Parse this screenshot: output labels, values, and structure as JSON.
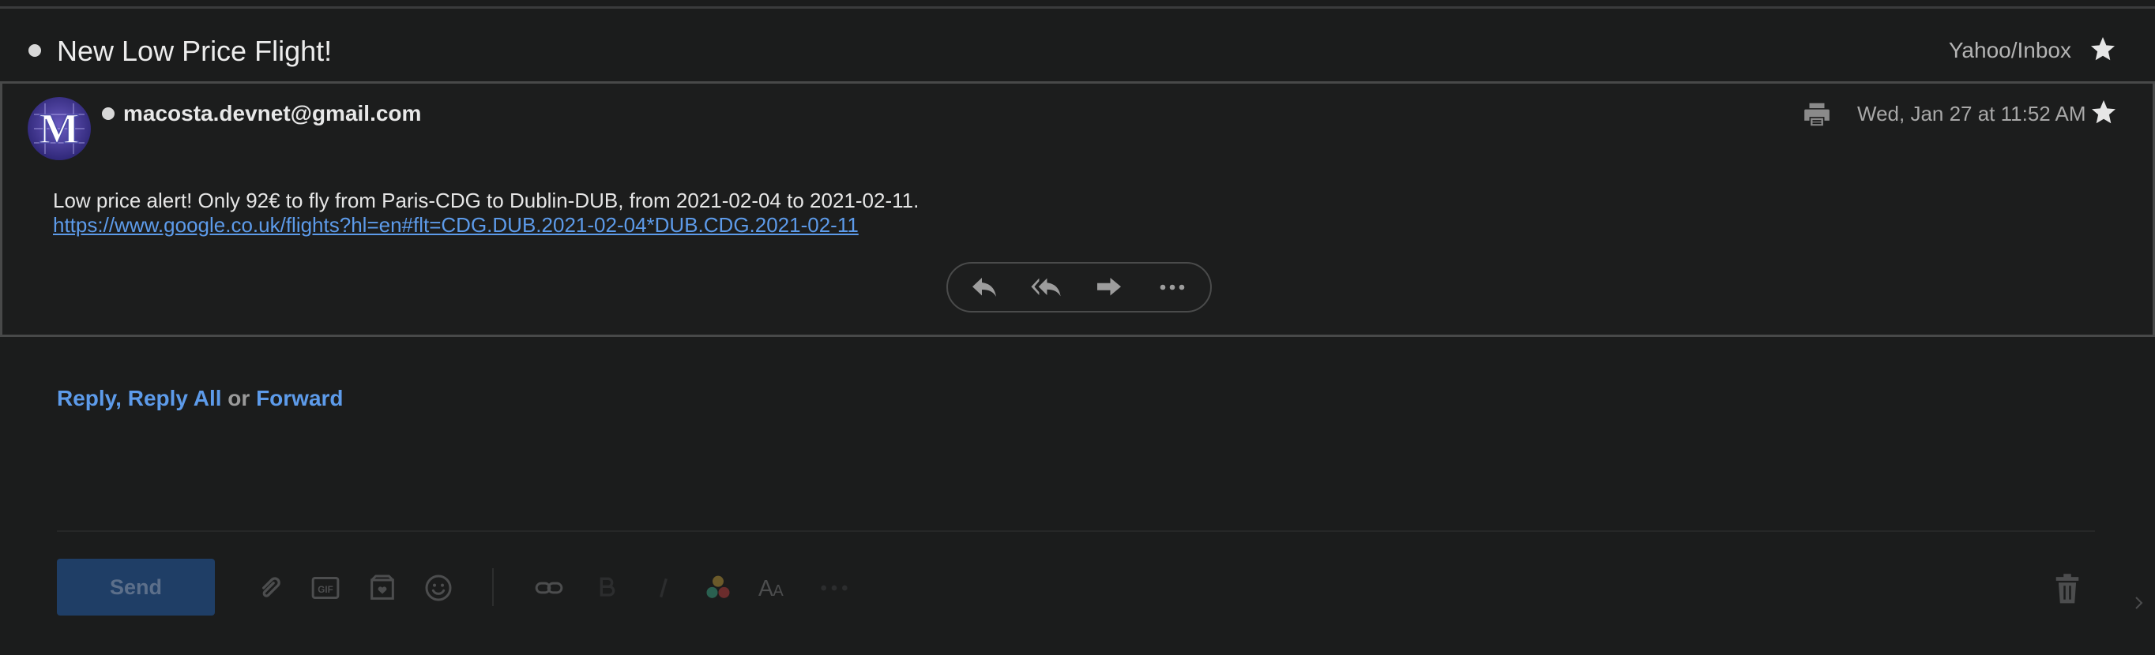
{
  "header": {
    "subject": "New Low Price Flight!",
    "folder": "Yahoo/Inbox"
  },
  "message": {
    "avatar_letter": "M",
    "sender": "macosta.devnet@gmail.com",
    "date": "Wed, Jan 27 at 11:52 AM",
    "body_text": "Low price alert! Only 92€ to fly from Paris-CDG to Dublin-DUB, from 2021-02-04 to 2021-02-11.",
    "body_link": "https://www.google.co.uk/flights?hl=en#flt=CDG.DUB.2021-02-04*DUB.CDG.2021-02-11",
    "actions": [
      "reply-icon",
      "reply-all-icon",
      "forward-icon",
      "more-icon"
    ]
  },
  "quick_reply": {
    "reply": "Reply",
    "sep1": ", ",
    "reply_all": "Reply All",
    "or": " or ",
    "forward": "Forward"
  },
  "composer": {
    "send_label": "Send",
    "gif_label": "GIF",
    "tools": [
      "attach-icon",
      "gif-icon",
      "sticker-icon",
      "emoji-icon",
      "link-icon",
      "bold-icon",
      "italic-icon",
      "color-icon",
      "font-size-icon",
      "more-formatting-icon",
      "trash-icon"
    ]
  },
  "colors": {
    "background": "#1b1c1c",
    "accent_link": "#5d9bea",
    "send_button": "#1f3e66"
  }
}
